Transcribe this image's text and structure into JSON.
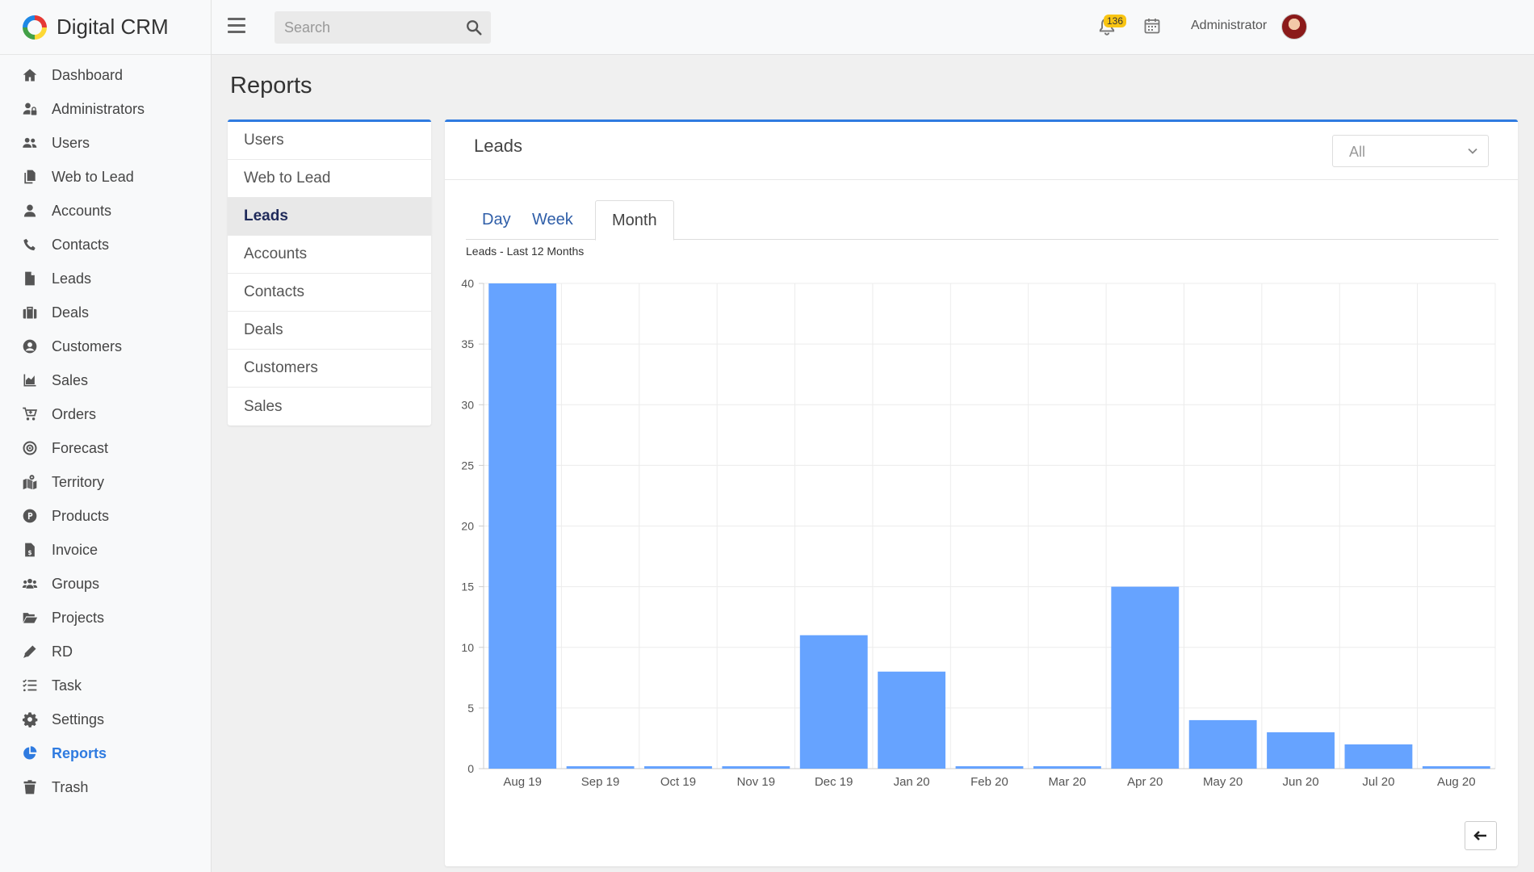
{
  "app": {
    "name": "Digital CRM"
  },
  "sidebar": {
    "items": [
      {
        "label": "Dashboard",
        "icon": "home-icon",
        "active": false
      },
      {
        "label": "Administrators",
        "icon": "user-lock-icon",
        "active": false
      },
      {
        "label": "Users",
        "icon": "users-icon",
        "active": false
      },
      {
        "label": "Web to Lead",
        "icon": "copy-icon",
        "active": false
      },
      {
        "label": "Accounts",
        "icon": "user-icon",
        "active": false
      },
      {
        "label": "Contacts",
        "icon": "phone-icon",
        "active": false
      },
      {
        "label": "Leads",
        "icon": "file-icon",
        "active": false
      },
      {
        "label": "Deals",
        "icon": "briefcase-icon",
        "active": false
      },
      {
        "label": "Customers",
        "icon": "user-circle-icon",
        "active": false
      },
      {
        "label": "Sales",
        "icon": "area-chart-icon",
        "active": false
      },
      {
        "label": "Orders",
        "icon": "cart-plus-icon",
        "active": false
      },
      {
        "label": "Forecast",
        "icon": "bullseye-icon",
        "active": false
      },
      {
        "label": "Territory",
        "icon": "map-marked-icon",
        "active": false
      },
      {
        "label": "Products",
        "icon": "product-p-icon",
        "active": false
      },
      {
        "label": "Invoice",
        "icon": "invoice-dollar-icon",
        "active": false
      },
      {
        "label": "Groups",
        "icon": "groups-icon",
        "active": false
      },
      {
        "label": "Projects",
        "icon": "folder-open-icon",
        "active": false
      },
      {
        "label": "RD",
        "icon": "pencil-icon",
        "active": false
      },
      {
        "label": "Task",
        "icon": "tasks-icon",
        "active": false
      },
      {
        "label": "Settings",
        "icon": "gear-icon",
        "active": false
      },
      {
        "label": "Reports",
        "icon": "pie-chart-icon",
        "active": true
      },
      {
        "label": "Trash",
        "icon": "trash-icon",
        "active": false
      }
    ]
  },
  "topbar": {
    "search_placeholder": "Search",
    "notification_count": "136",
    "user_name": "Administrator"
  },
  "page": {
    "title": "Reports"
  },
  "report_menu": {
    "items": [
      {
        "label": "Users",
        "active": false
      },
      {
        "label": "Web to Lead",
        "active": false
      },
      {
        "label": "Leads",
        "active": true
      },
      {
        "label": "Accounts",
        "active": false
      },
      {
        "label": "Contacts",
        "active": false
      },
      {
        "label": "Deals",
        "active": false
      },
      {
        "label": "Customers",
        "active": false
      },
      {
        "label": "Sales",
        "active": false
      }
    ]
  },
  "card": {
    "title": "Leads",
    "filter_value": "All",
    "tabs": [
      {
        "label": "Day",
        "active": false
      },
      {
        "label": "Week",
        "active": false
      },
      {
        "label": "Month",
        "active": true
      }
    ]
  },
  "colors": {
    "accent": "#2f7be0",
    "bar": "#66a3ff",
    "badge": "#f9c513"
  },
  "chart_data": {
    "type": "bar",
    "title": "Leads - Last 12 Months",
    "xlabel": "",
    "ylabel": "",
    "categories": [
      "Aug 19",
      "Sep 19",
      "Oct 19",
      "Nov 19",
      "Dec 19",
      "Jan 20",
      "Feb 20",
      "Mar 20",
      "Apr 20",
      "May 20",
      "Jun 20",
      "Jul 20",
      "Aug 20"
    ],
    "values": [
      40,
      0,
      0,
      0,
      11,
      8,
      0,
      0,
      15,
      4,
      3,
      2,
      0
    ],
    "ylim": [
      0,
      40
    ],
    "yticks": [
      0,
      5,
      10,
      15,
      20,
      25,
      30,
      35,
      40
    ],
    "grid": true,
    "legend": "none"
  }
}
